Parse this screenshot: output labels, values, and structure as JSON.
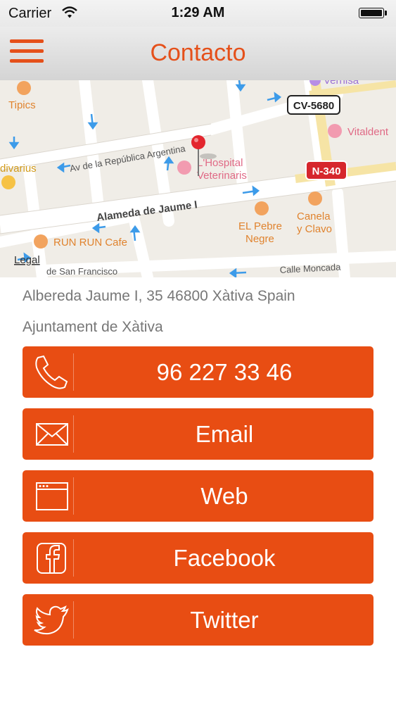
{
  "status_bar": {
    "carrier": "Carrier",
    "time": "1:29 AM"
  },
  "nav": {
    "title": "Contacto",
    "menu_icon": "hamburger-icon"
  },
  "map": {
    "legal": "Legal",
    "labels": {
      "tipics": "Tipics",
      "vernisa": "Vernisa",
      "vitaldent": "Vitaldent",
      "cv5680": "CV-5680",
      "av_republica": "Av de la República Argentina",
      "hospital_1": "L'Hospital",
      "hospital_2": "Veterinaris",
      "divarius": "divarius",
      "n340": "N-340",
      "alameda": "Alameda de Jaume I",
      "pebre_1": "EL Pebre",
      "pebre_2": "Negre",
      "canela_1": "Canela",
      "canela_2": "y Clavo",
      "runrun": "RUN RUN Cafe",
      "san_francisco": "de San Francisco",
      "moncada": "Calle Moncada"
    }
  },
  "contact": {
    "address": "Albereda Jaume I, 35 46800 Xàtiva Spain",
    "venue": "Ajuntament de Xàtiva"
  },
  "buttons": [
    {
      "label": "96 227 33 46",
      "icon": "phone-icon"
    },
    {
      "label": "Email",
      "icon": "envelope-icon"
    },
    {
      "label": "Web",
      "icon": "browser-window-icon"
    },
    {
      "label": "Facebook",
      "icon": "facebook-icon"
    },
    {
      "label": "Twitter",
      "icon": "twitter-bird-icon"
    }
  ],
  "colors": {
    "accent": "#e5501a",
    "button": "#e84d13",
    "text_gray": "#777777"
  }
}
